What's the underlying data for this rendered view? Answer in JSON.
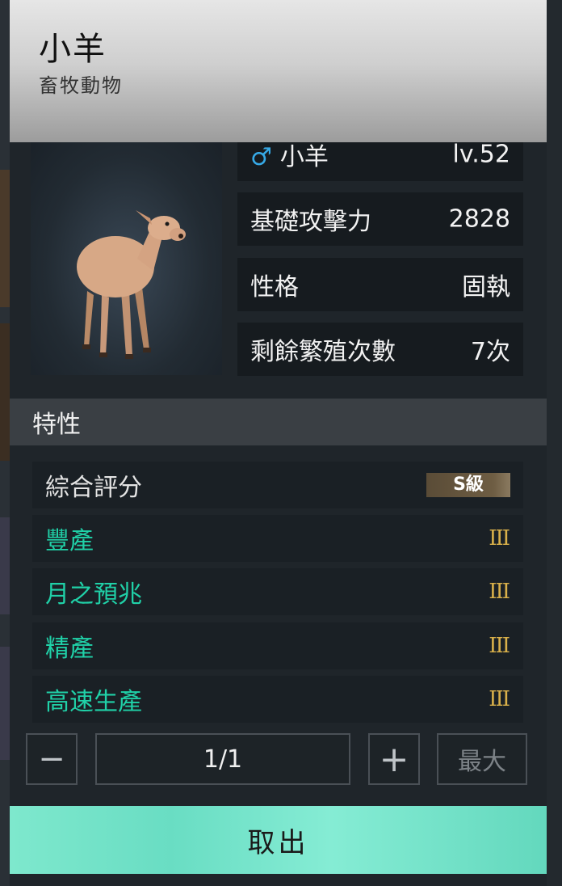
{
  "header": {
    "title": "小羊",
    "subtitle": "畜牧動物"
  },
  "stats": {
    "name_row": {
      "gender_icon": "♂",
      "name": "小羊",
      "level": "lv.52"
    },
    "attack": {
      "label": "基礎攻擊力",
      "value": "2828"
    },
    "personality": {
      "label": "性格",
      "value": "固執"
    },
    "breeding": {
      "label": "剩餘繁殖次數",
      "value": "7次"
    }
  },
  "traits_section": {
    "title": "特性",
    "overall": {
      "label": "綜合評分",
      "grade": "S級"
    },
    "items": [
      {
        "name": "豐產",
        "rank": "III"
      },
      {
        "name": "月之預兆",
        "rank": "III"
      },
      {
        "name": "精產",
        "rank": "III"
      },
      {
        "name": "高速生產",
        "rank": "III"
      }
    ]
  },
  "quantity": {
    "minus_icon": "−",
    "value": "1/1",
    "plus_icon": "+",
    "max_label": "最大"
  },
  "confirm_label": "取出",
  "colors": {
    "trait_name": "#20d1a8",
    "rank": "#d9b04a",
    "male": "#36a9e6",
    "confirm": "#6fe2c7"
  }
}
